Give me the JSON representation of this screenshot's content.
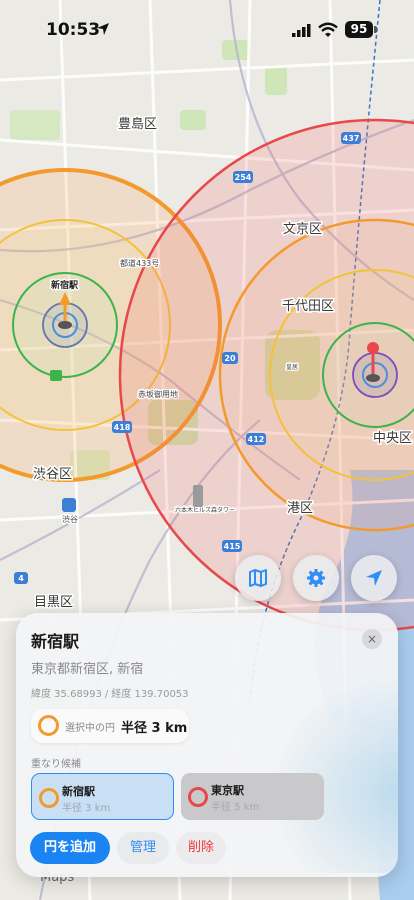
{
  "status": {
    "time": "10:53",
    "battery": "95"
  },
  "map_labels": {
    "toshima": "豊島区",
    "bunkyo": "文京区",
    "chiyoda": "千代田区",
    "chuo": "中央区",
    "shibuya": "渋谷区",
    "minato": "港区",
    "meguro": "目黒区",
    "akasaka": "赤坂御用地",
    "roppongi": "六本木ヒルズ森タワー",
    "road433": "都道433号",
    "shibuya_station": "渋谷",
    "shinjuku_pin": "新宿駅",
    "kokyo": "皇居",
    "r254": "254",
    "r437": "437",
    "r20": "20",
    "r418": "418",
    "r412": "412",
    "r415": "415",
    "r4": "4"
  },
  "sheet": {
    "title": "新宿駅",
    "close_label": "×",
    "address": "東京都新宿区, 新宿",
    "lat_label": "緯度 35.68993",
    "separator": "/",
    "lon_label": "経度 139.70053",
    "selected_label": "選択中の円",
    "selected_value": "半径 3 km",
    "overlap_label": "重なり候補",
    "candidates": [
      {
        "name": "新宿駅",
        "sub": "半径 3 km"
      },
      {
        "name": "東京駅",
        "sub": "半径 5 km"
      }
    ],
    "add_button": "円を追加",
    "manage_button": "管理",
    "delete_button": "削除"
  },
  "watermark": {
    "maps": "Maps"
  },
  "colors": {
    "orange": "#f39a2c",
    "red": "#e8484b",
    "yellow": "#f2c23a",
    "green": "#3cb44b",
    "blue": "#2f8df5",
    "purple": "#7a4fb8"
  }
}
